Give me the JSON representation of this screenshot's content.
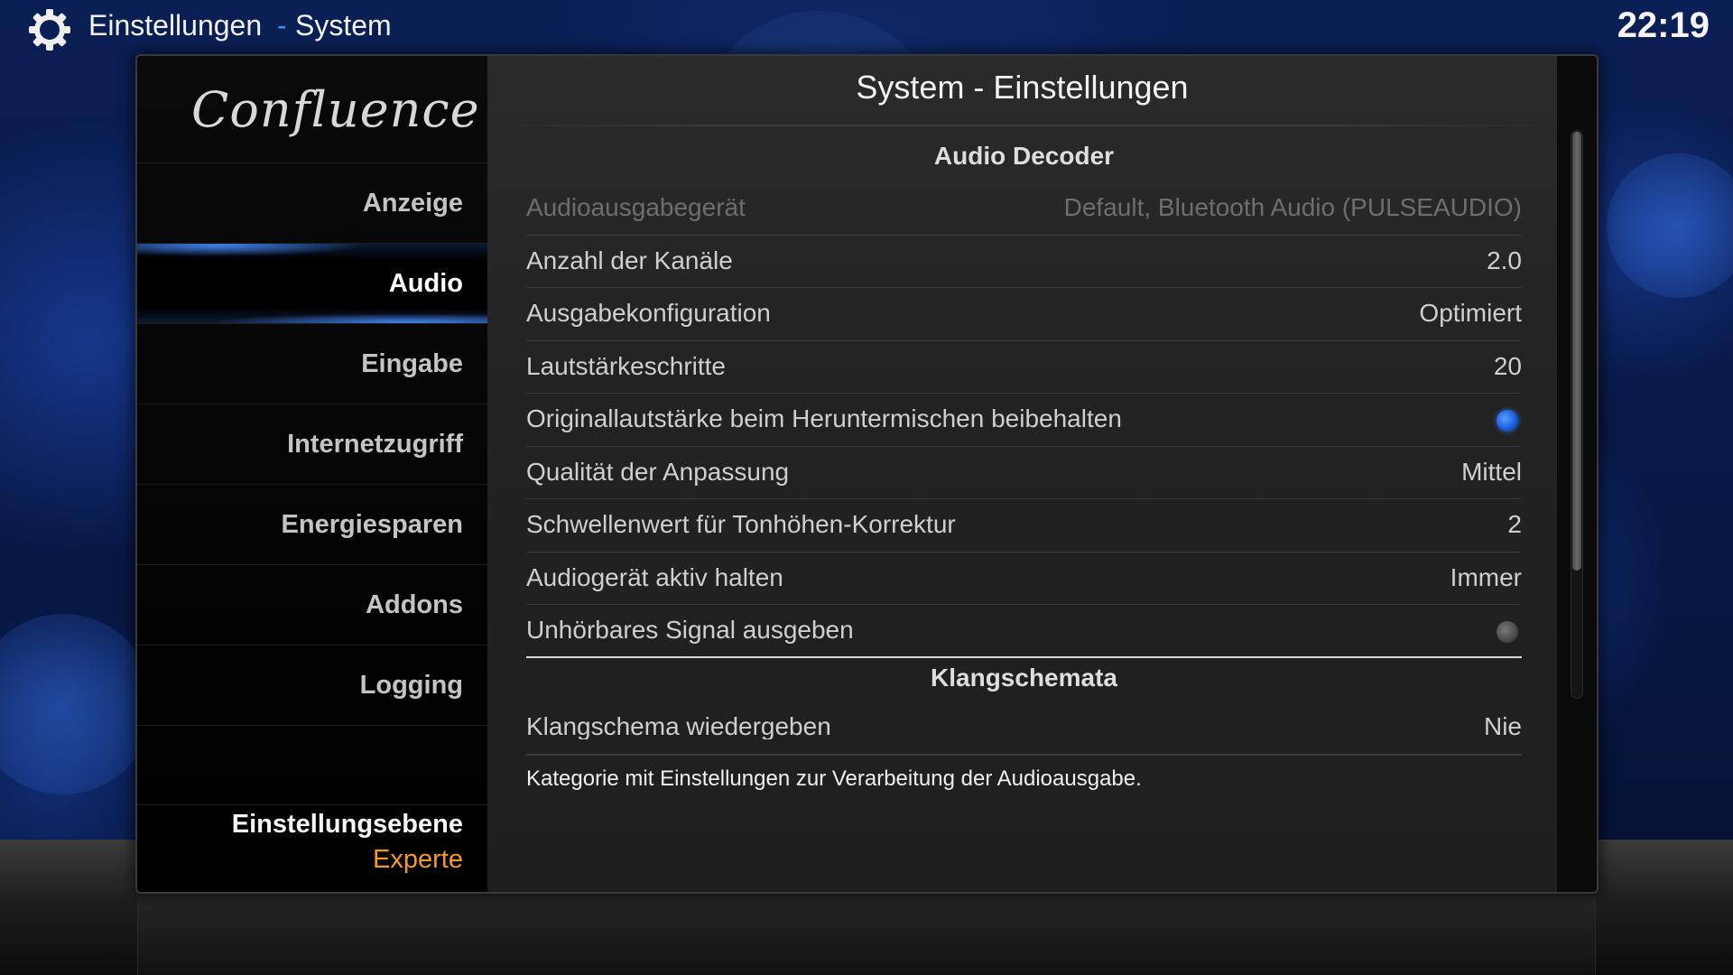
{
  "header": {
    "title": "Einstellungen",
    "separator": "-",
    "subtitle": "System",
    "clock": "22:19",
    "icon": "gear-icon"
  },
  "sidebar": {
    "logo": "Confluence",
    "items": [
      {
        "label": "Anzeige",
        "active": false
      },
      {
        "label": "Audio",
        "active": true
      },
      {
        "label": "Eingabe",
        "active": false
      },
      {
        "label": "Internetzugriff",
        "active": false
      },
      {
        "label": "Energiesparen",
        "active": false
      },
      {
        "label": "Addons",
        "active": false
      },
      {
        "label": "Logging",
        "active": false
      }
    ],
    "level_label": "Einstellungsebene",
    "level_value": "Experte"
  },
  "content": {
    "title": "System - Einstellungen",
    "groups": [
      {
        "heading": "Audio Decoder",
        "rows": [
          {
            "label": "Audioausgabegerät",
            "value": "Default, Bluetooth Audio (PULSEAUDIO)",
            "disabled": true
          },
          {
            "label": "Anzahl der Kanäle",
            "value": "2.0"
          },
          {
            "label": "Ausgabekonfiguration",
            "value": "Optimiert"
          },
          {
            "label": "Lautstärkeschritte",
            "value": "20"
          },
          {
            "label": "Originallautstärke beim Heruntermischen beibehalten",
            "toggle": true
          },
          {
            "label": "Qualität der Anpassung",
            "value": "Mittel"
          },
          {
            "label": "Schwellenwert für Tonhöhen-Korrektur",
            "value": "2"
          },
          {
            "label": "Audiogerät aktiv halten",
            "value": "Immer"
          },
          {
            "label": "Unhörbares Signal ausgeben",
            "toggle": false
          }
        ]
      },
      {
        "heading": "Klangschemata",
        "rows": [
          {
            "label": "Klangschema wiedergeben",
            "value": "Nie"
          }
        ]
      }
    ],
    "description": "Kategorie mit Einstellungen zur Verarbeitung der Audioausgabe."
  },
  "scrollbar": {
    "position": 0,
    "visible_fraction": 0.77
  },
  "colors": {
    "accent_blue": "#3a8ff2",
    "level_orange": "#f59a1f",
    "background": "#06163a"
  }
}
